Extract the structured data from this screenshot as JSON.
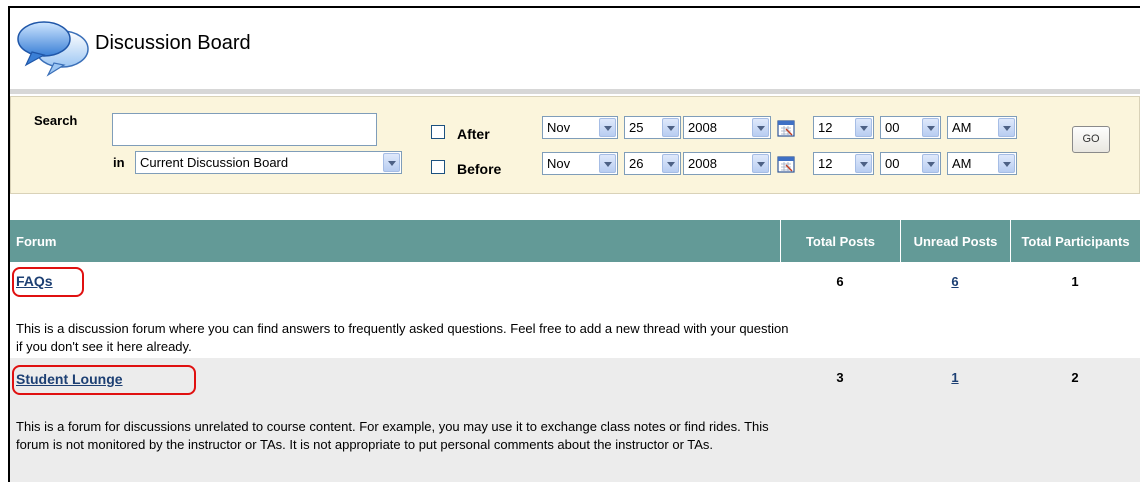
{
  "page": {
    "title": "Discussion Board"
  },
  "search": {
    "label": "Search",
    "in_label": "in",
    "query_value": "",
    "scope": "Current Discussion Board",
    "after_label": "After",
    "before_label": "Before",
    "after": {
      "month": "Nov",
      "day": "25",
      "year": "2008",
      "hour": "12",
      "minute": "00",
      "ampm": "AM"
    },
    "before": {
      "month": "Nov",
      "day": "26",
      "year": "2008",
      "hour": "12",
      "minute": "00",
      "ampm": "AM"
    },
    "go_label": "GO"
  },
  "table": {
    "columns": {
      "forum": "Forum",
      "total_posts": "Total Posts",
      "unread_posts": "Unread Posts",
      "total_participants": "Total Participants"
    },
    "rows": [
      {
        "name": "FAQs",
        "description": "This is a discussion forum where you can find answers to frequently asked questions. Feel free to add a new thread with your question if you don't see it here already.",
        "total_posts": "6",
        "unread_posts": "6",
        "total_participants": "1"
      },
      {
        "name": "Student Lounge",
        "description": "This is a forum for discussions unrelated to course content. For example, you may use it to exchange class notes or find rides. This forum is not monitored by the instructor or TAs. It is not appropriate to put personal comments about the instructor or TAs.",
        "total_posts": "3",
        "unread_posts": "1",
        "total_participants": "2"
      }
    ]
  },
  "colors": {
    "table_header": "#639a97",
    "search_panel": "#fbf5dc",
    "link": "#1c3f73",
    "highlight": "#e01010"
  }
}
